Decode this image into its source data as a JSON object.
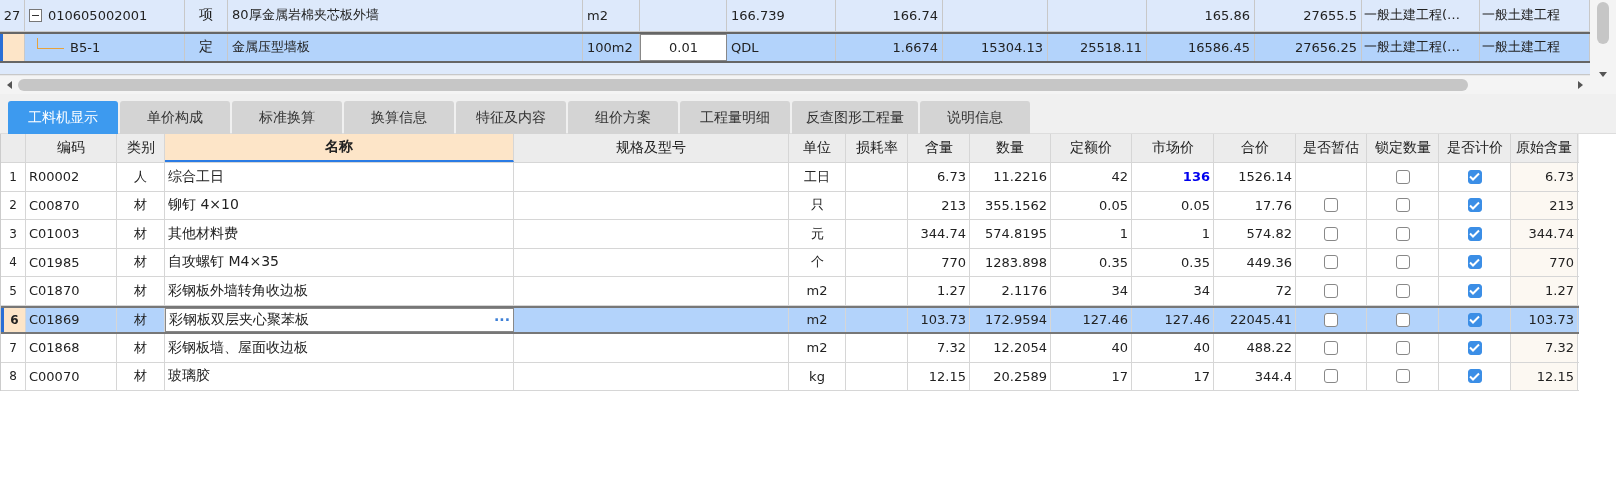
{
  "top_grid": {
    "rows": [
      {
        "num": "27",
        "code": "010605002001",
        "expanded": true,
        "selected": false,
        "type": "项",
        "name": "80厚金属岩棉夹芯板外墙",
        "unit": "m2",
        "column_7": "166.739",
        "column_8": "166.74",
        "column_11": "165.86",
        "column_12": "27655.5",
        "column_13": "一般土建工程(…",
        "column_14": "一般土建工程",
        "children": [
          {
            "code": "B5-1",
            "selected": true,
            "type": "定",
            "name": "金属压型墙板",
            "unit": "100m2",
            "column_6": "0.01",
            "column_7": "QDL",
            "column_8": "1.6674",
            "column_9": "15304.13",
            "column_10": "25518.11",
            "column_11": "16586.45",
            "column_12": "27656.25",
            "column_13": "一般土建工程(…",
            "column_14": "一般土建工程"
          }
        ]
      }
    ]
  },
  "tabs": [
    {
      "label": "工料机显示",
      "selected": true
    },
    {
      "label": "单价构成",
      "selected": false
    },
    {
      "label": "标准换算",
      "selected": false
    },
    {
      "label": "换算信息",
      "selected": false
    },
    {
      "label": "特征及内容",
      "selected": false
    },
    {
      "label": "组价方案",
      "selected": false
    },
    {
      "label": "工程量明细",
      "selected": false
    },
    {
      "label": "反查图形工程量",
      "selected": false
    },
    {
      "label": "说明信息",
      "selected": false
    }
  ],
  "table": {
    "columns": [
      {
        "label": "编码",
        "selected": false
      },
      {
        "label": "类别",
        "selected": false
      },
      {
        "label": "名称",
        "selected": true
      },
      {
        "label": "规格及型号",
        "selected": false
      },
      {
        "label": "单位",
        "selected": false
      },
      {
        "label": "损耗率",
        "selected": false
      },
      {
        "label": "含量",
        "selected": false
      },
      {
        "label": "数量",
        "selected": false
      },
      {
        "label": "定额价",
        "selected": false
      },
      {
        "label": "市场价",
        "selected": false
      },
      {
        "label": "合价",
        "selected": false
      },
      {
        "label": "是否暂估",
        "selected": false
      },
      {
        "label": "锁定数量",
        "selected": false
      },
      {
        "label": "是否计价",
        "selected": false
      },
      {
        "label": "原始含量",
        "selected": false
      }
    ],
    "rows": [
      {
        "num": "1",
        "code": "R00002",
        "type": "人",
        "name": "综合工日",
        "unit": "工日",
        "content": "6.73",
        "quantity": "11.2216",
        "quota_price": "42",
        "market_price": "136",
        "market_changed": true,
        "total": "1526.14",
        "locked": false,
        "priced": true,
        "original": "6.73",
        "selected": false
      },
      {
        "num": "2",
        "code": "C00870",
        "type": "材",
        "name": "铆钉 4×10",
        "unit": "只",
        "content": "213",
        "quantity": "355.1562",
        "quota_price": "0.05",
        "market_price": "0.05",
        "market_changed": false,
        "total": "17.76",
        "estimate": false,
        "locked": false,
        "priced": true,
        "original": "213",
        "selected": false
      },
      {
        "num": "3",
        "code": "C01003",
        "type": "材",
        "name": "其他材料费",
        "unit": "元",
        "content": "344.74",
        "quantity": "574.8195",
        "quota_price": "1",
        "market_price": "1",
        "market_changed": false,
        "total": "574.82",
        "estimate": false,
        "locked": false,
        "priced": true,
        "original": "344.74",
        "selected": false
      },
      {
        "num": "4",
        "code": "C01985",
        "type": "材",
        "name": "自攻螺钉 M4×35",
        "unit": "个",
        "content": "770",
        "quantity": "1283.898",
        "quota_price": "0.35",
        "market_price": "0.35",
        "market_changed": false,
        "total": "449.36",
        "estimate": false,
        "locked": false,
        "priced": true,
        "original": "770",
        "selected": false
      },
      {
        "num": "5",
        "code": "C01870",
        "type": "材",
        "name": "彩钢板外墙转角收边板",
        "unit": "m2",
        "content": "1.27",
        "quantity": "2.1176",
        "quota_price": "34",
        "market_price": "34",
        "market_changed": false,
        "total": "72",
        "estimate": false,
        "locked": false,
        "priced": true,
        "original": "1.27",
        "selected": false
      },
      {
        "num": "6",
        "code": "C01869",
        "type": "材",
        "name": "彩钢板双层夹心聚苯板",
        "unit": "m2",
        "content": "103.73",
        "quantity": "172.9594",
        "quota_price": "127.46",
        "market_price": "127.46",
        "market_changed": false,
        "total": "22045.41",
        "estimate": false,
        "locked": false,
        "priced": true,
        "original": "103.73",
        "selected": true,
        "more": "···"
      },
      {
        "num": "7",
        "code": "C01868",
        "type": "材",
        "name": "彩钢板墙、屋面收边板",
        "unit": "m2",
        "content": "7.32",
        "quantity": "12.2054",
        "quota_price": "40",
        "market_price": "40",
        "market_changed": false,
        "total": "488.22",
        "estimate": false,
        "locked": false,
        "priced": true,
        "original": "7.32",
        "selected": false
      },
      {
        "num": "8",
        "code": "C00070",
        "type": "材",
        "name": "玻璃胶",
        "unit": "kg",
        "content": "12.15",
        "quantity": "20.2589",
        "quota_price": "17",
        "market_price": "17",
        "market_changed": false,
        "total": "344.4",
        "estimate": false,
        "locked": false,
        "priced": true,
        "original": "12.15",
        "selected": false
      }
    ]
  }
}
